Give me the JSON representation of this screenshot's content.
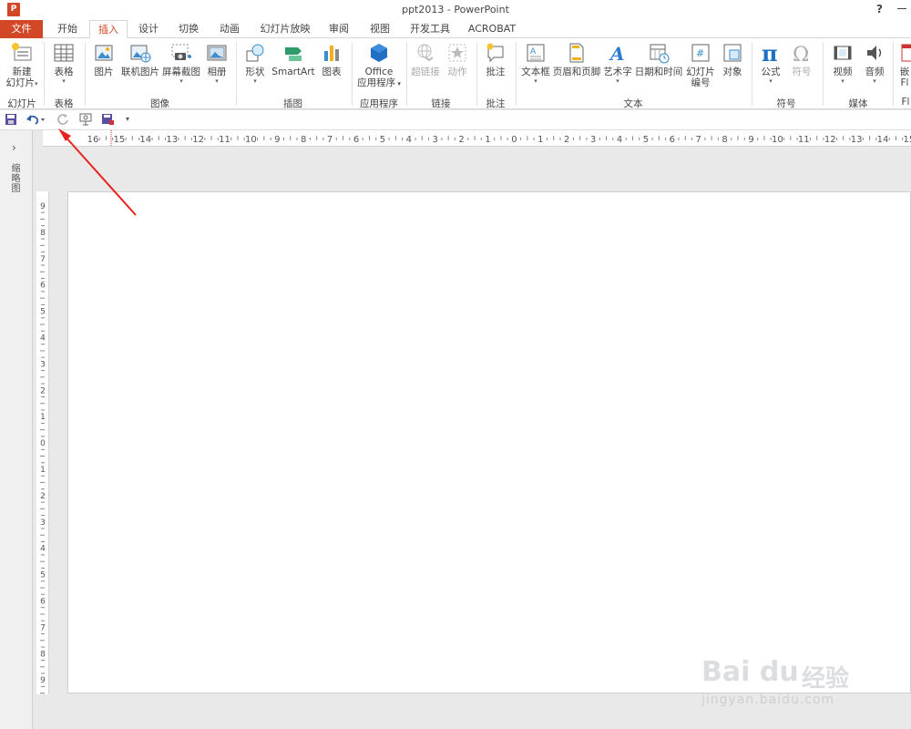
{
  "window": {
    "title": "ppt2013 - PowerPoint",
    "help": "?",
    "app_icon_letter": "P"
  },
  "tabs": [
    {
      "label": "文件"
    },
    {
      "label": "开始"
    },
    {
      "label": "插入"
    },
    {
      "label": "设计"
    },
    {
      "label": "切换"
    },
    {
      "label": "动画"
    },
    {
      "label": "幻灯片放映"
    },
    {
      "label": "审阅"
    },
    {
      "label": "视图"
    },
    {
      "label": "开发工具"
    },
    {
      "label": "ACROBAT"
    }
  ],
  "active_tab": "插入",
  "ribbon": {
    "groups": {
      "slides": "幻灯片",
      "tables": "表格",
      "images": "图像",
      "illustrations": "插图",
      "apps": "应用程序",
      "links": "链接",
      "comments": "批注",
      "text": "文本",
      "symbols": "符号",
      "media": "媒体",
      "flash": "Fl"
    },
    "buttons": {
      "new_slide_l1": "新建",
      "new_slide_l2": "幻灯片",
      "table": "表格",
      "picture": "图片",
      "online_picture": "联机图片",
      "screenshot": "屏幕截图",
      "album": "相册",
      "shapes": "形状",
      "smartart": "SmartArt",
      "chart": "图表",
      "office_apps_l1": "Office",
      "office_apps_l2": "应用程序",
      "hyperlink": "超链接",
      "action": "动作",
      "comment": "批注",
      "textbox": "文本框",
      "header_footer": "页眉和页脚",
      "wordart": "艺术字",
      "datetime": "日期和时间",
      "slide_number_l1": "幻灯片",
      "slide_number_l2": "编号",
      "object": "对象",
      "equation": "公式",
      "symbol": "符号",
      "video": "视频",
      "audio": "音频",
      "flash_l1": "嵌",
      "flash_l2": "Fl"
    }
  },
  "thumbnail_pane": {
    "label": "缩略图"
  },
  "ruler": {
    "h_labels": [
      "16",
      "15",
      "14",
      "13",
      "12",
      "11",
      "10",
      "9",
      "8",
      "7",
      "6",
      "5",
      "4",
      "3",
      "2",
      "1",
      "0",
      "1",
      "2",
      "3",
      "4",
      "5",
      "6",
      "7",
      "8",
      "9",
      "10",
      "11",
      "12",
      "13",
      "14",
      "15"
    ],
    "v_labels": [
      "9",
      "8",
      "7",
      "6",
      "5",
      "4",
      "3",
      "2",
      "1",
      "0",
      "1",
      "2",
      "3",
      "4",
      "5",
      "6",
      "7",
      "8",
      "9"
    ]
  },
  "watermark": {
    "brand": "Bai du",
    "cn": "经验",
    "url": "jingyan.baidu.com"
  },
  "colors": {
    "accent": "#d24726",
    "annotation_arrow": "#e8221d"
  }
}
